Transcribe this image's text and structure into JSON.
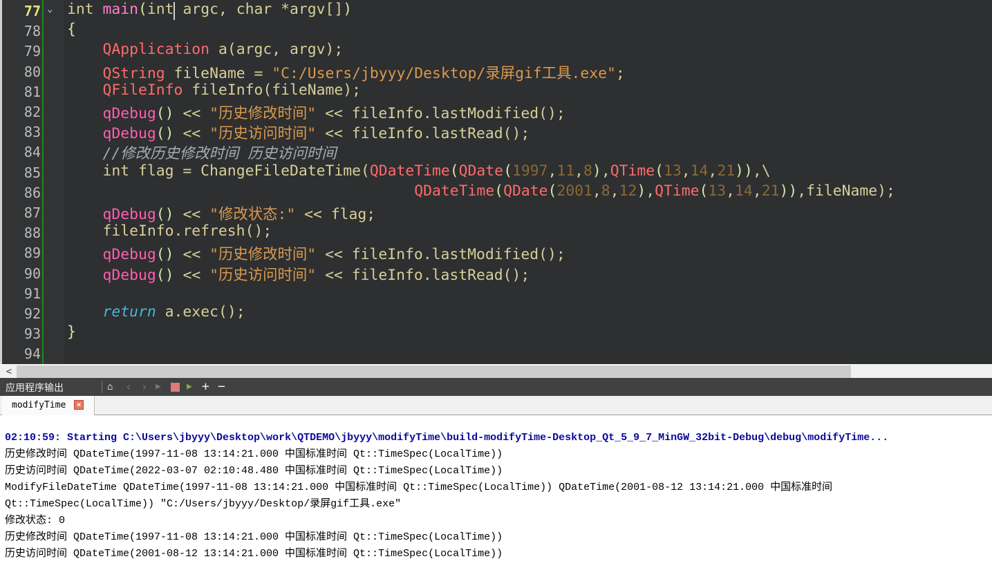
{
  "editor": {
    "current_line": 77,
    "lines": [
      {
        "n": 77,
        "seg": [
          [
            "int ",
            "kw"
          ],
          [
            "main",
            "main"
          ],
          [
            "(",
            "p"
          ],
          [
            "int",
            "kw"
          ],
          [
            " argc, ",
            "kw"
          ],
          [
            "char",
            "kw"
          ],
          [
            " *argv[]",
            "kw"
          ],
          [
            ")",
            "p"
          ]
        ]
      },
      {
        "n": 78,
        "seg": [
          [
            "{",
            "p"
          ]
        ]
      },
      {
        "n": 79,
        "seg": [
          [
            "    ",
            ""
          ],
          [
            "QApplication",
            "type"
          ],
          [
            " a(argc, argv);",
            ""
          ]
        ]
      },
      {
        "n": 80,
        "seg": [
          [
            "    ",
            ""
          ],
          [
            "QString",
            "type"
          ],
          [
            " fileName = ",
            ""
          ],
          [
            "\"C:/Users/jbyyy/Desktop/录屏gif工具.exe\"",
            "str"
          ],
          [
            ";",
            ""
          ]
        ]
      },
      {
        "n": 81,
        "seg": [
          [
            "    ",
            ""
          ],
          [
            "QFileInfo",
            "type"
          ],
          [
            " fileInfo(fileName);",
            ""
          ]
        ]
      },
      {
        "n": 82,
        "seg": [
          [
            "    ",
            ""
          ],
          [
            "qDebug",
            "fn"
          ],
          [
            "()",
            "p"
          ],
          [
            " << ",
            ""
          ],
          [
            "\"历史修改时间\"",
            "str"
          ],
          [
            " << fileInfo.lastModified();",
            ""
          ]
        ]
      },
      {
        "n": 83,
        "seg": [
          [
            "    ",
            ""
          ],
          [
            "qDebug",
            "fn"
          ],
          [
            "()",
            "p"
          ],
          [
            " << ",
            ""
          ],
          [
            "\"历史访问时间\"",
            "str"
          ],
          [
            " << fileInfo.lastRead();",
            ""
          ]
        ]
      },
      {
        "n": 84,
        "seg": [
          [
            "    ",
            ""
          ],
          [
            "//修改历史修改时间 历史访问时间",
            "cm"
          ]
        ]
      },
      {
        "n": 85,
        "seg": [
          [
            "    ",
            ""
          ],
          [
            "int flag = ChangeFileDateTime(",
            ""
          ],
          [
            "QDateTime",
            "type"
          ],
          [
            "(",
            "p"
          ],
          [
            "QDate",
            "type"
          ],
          [
            "(",
            "p"
          ],
          [
            "1997",
            "num"
          ],
          [
            ",",
            ""
          ],
          [
            "11",
            "num"
          ],
          [
            ",",
            ""
          ],
          [
            "8",
            "num"
          ],
          [
            ")",
            "p"
          ],
          [
            ",",
            ""
          ],
          [
            "QTime",
            "type"
          ],
          [
            "(",
            "p"
          ],
          [
            "13",
            "num"
          ],
          [
            ",",
            ""
          ],
          [
            "14",
            "num"
          ],
          [
            ",",
            ""
          ],
          [
            "21",
            "num"
          ],
          [
            "))",
            "p"
          ],
          [
            ",\\",
            ""
          ]
        ]
      },
      {
        "n": 86,
        "seg": [
          [
            "                                       ",
            ""
          ],
          [
            "QDateTime",
            "type"
          ],
          [
            "(",
            "p"
          ],
          [
            "QDate",
            "type"
          ],
          [
            "(",
            "p"
          ],
          [
            "2001",
            "num"
          ],
          [
            ",",
            ""
          ],
          [
            "8",
            "num"
          ],
          [
            ",",
            ""
          ],
          [
            "12",
            "num"
          ],
          [
            ")",
            "p"
          ],
          [
            ",",
            ""
          ],
          [
            "QTime",
            "type"
          ],
          [
            "(",
            "p"
          ],
          [
            "13",
            "num"
          ],
          [
            ",",
            ""
          ],
          [
            "14",
            "num"
          ],
          [
            ",",
            ""
          ],
          [
            "21",
            "num"
          ],
          [
            "))",
            "p"
          ],
          [
            ",fileName);",
            ""
          ]
        ]
      },
      {
        "n": 87,
        "seg": [
          [
            "    ",
            ""
          ],
          [
            "qDebug",
            "fn"
          ],
          [
            "()",
            "p"
          ],
          [
            " << ",
            ""
          ],
          [
            "\"修改状态:\"",
            "str"
          ],
          [
            " << flag;",
            ""
          ]
        ]
      },
      {
        "n": 88,
        "seg": [
          [
            "    fileInfo.refresh();",
            ""
          ]
        ]
      },
      {
        "n": 89,
        "seg": [
          [
            "    ",
            ""
          ],
          [
            "qDebug",
            "fn"
          ],
          [
            "()",
            "p"
          ],
          [
            " << ",
            ""
          ],
          [
            "\"历史修改时间\"",
            "str"
          ],
          [
            " << fileInfo.lastModified();",
            ""
          ]
        ]
      },
      {
        "n": 90,
        "seg": [
          [
            "    ",
            ""
          ],
          [
            "qDebug",
            "fn"
          ],
          [
            "()",
            "p"
          ],
          [
            " << ",
            ""
          ],
          [
            "\"历史访问时间\"",
            "str"
          ],
          [
            " << fileInfo.lastRead();",
            ""
          ]
        ]
      },
      {
        "n": 91,
        "seg": []
      },
      {
        "n": 92,
        "seg": [
          [
            "    ",
            ""
          ],
          [
            "return",
            "ret"
          ],
          [
            " a.exec();",
            ""
          ]
        ]
      },
      {
        "n": 93,
        "seg": [
          [
            "}",
            "p"
          ]
        ]
      },
      {
        "n": 94,
        "seg": []
      }
    ]
  },
  "panel": {
    "title": "应用程序输出",
    "toolbar_icons": [
      "clear-icon",
      "previous-icon",
      "next-icon",
      "run-icon",
      "stop-icon",
      "attach-debugger-icon",
      "zoom-in-icon",
      "zoom-out-icon"
    ],
    "tab_label": "modifyTime",
    "stop_color": "#e07a7a"
  },
  "output": {
    "lines": [
      "02:10:59: Starting C:\\Users\\jbyyy\\Desktop\\work\\QTDEMO\\jbyyy\\modifyTime\\build-modifyTime-Desktop_Qt_5_9_7_MinGW_32bit-Debug\\debug\\modifyTime...",
      "历史修改时间 QDateTime(1997-11-08 13:14:21.000 中国标准时间 Qt::TimeSpec(LocalTime))",
      "历史访问时间 QDateTime(2022-03-07 02:10:48.480 中国标准时间 Qt::TimeSpec(LocalTime))",
      "ModifyFileDateTime QDateTime(1997-11-08 13:14:21.000 中国标准时间 Qt::TimeSpec(LocalTime)) QDateTime(2001-08-12 13:14:21.000 中国标准时间",
      "Qt::TimeSpec(LocalTime)) \"C:/Users/jbyyy/Desktop/录屏gif工具.exe\"",
      "修改状态: 0",
      "历史修改时间 QDateTime(1997-11-08 13:14:21.000 中国标准时间 Qt::TimeSpec(LocalTime))",
      "历史访问时间 QDateTime(2001-08-12 13:14:21.000 中国标准时间 Qt::TimeSpec(LocalTime))"
    ]
  }
}
